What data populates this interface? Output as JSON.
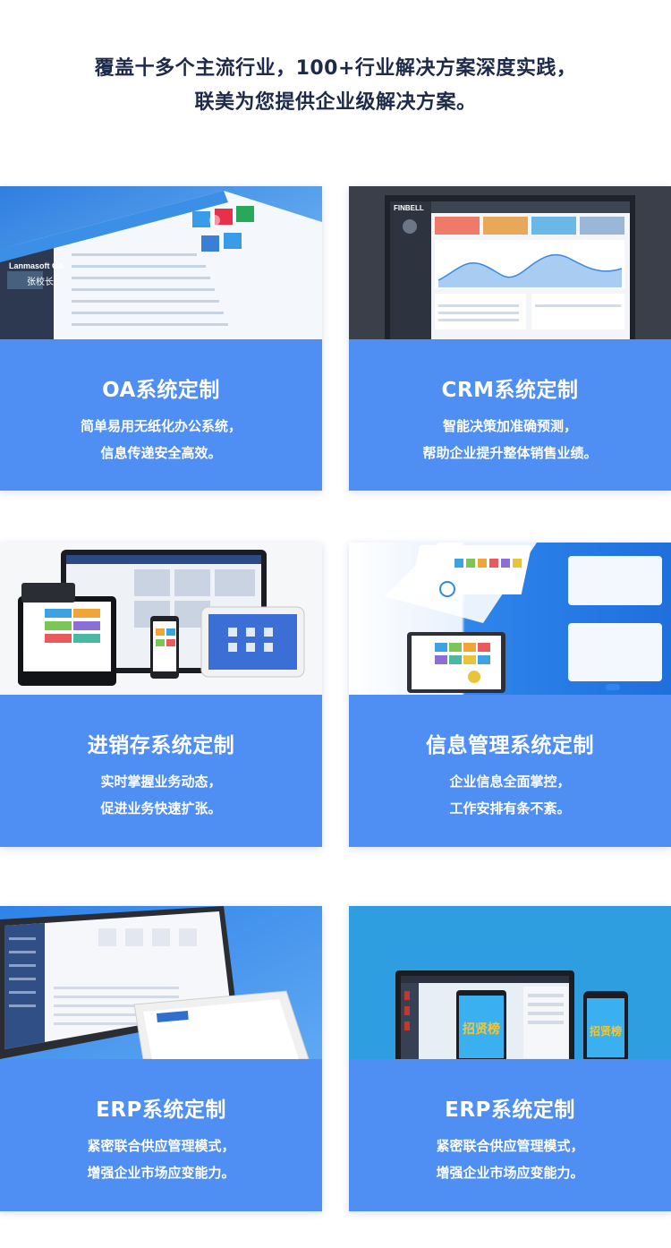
{
  "headline": {
    "line1": "覆盖十多个主流行业，100+行业解决方案深度实践，",
    "line2": "联美为您提供企业级解决方案。"
  },
  "cards": [
    {
      "title": "OA系统定制",
      "desc1": "简单易用无纸化办公系统，",
      "desc2": "信息传递安全高效。",
      "image_labels": [
        "Lanmasoft OA",
        "张校长"
      ]
    },
    {
      "title": "CRM系统定制",
      "desc1": "智能决策加准确预测，",
      "desc2": "帮助企业提升整体销售业绩。",
      "image_labels": [
        "FINBELL"
      ]
    },
    {
      "title": "进销存系统定制",
      "desc1": "实时掌握业务动态，",
      "desc2": "促进业务快速扩张。"
    },
    {
      "title": "信息管理系统定制",
      "desc1": "企业信息全面掌控，",
      "desc2": "工作安排有条不紊。"
    },
    {
      "title": "ERP系统定制",
      "desc1": "紧密联合供应管理模式，",
      "desc2": "增强企业市场应变能力。"
    },
    {
      "title": "ERP系统定制",
      "desc1": "紧密联合供应管理模式，",
      "desc2": "增强企业市场应变能力。",
      "image_labels": [
        "招贤榜",
        "招贤榜"
      ]
    }
  ],
  "colors": {
    "card_blue": "#4f8ef2",
    "headline_text": "#1e2a4a"
  }
}
